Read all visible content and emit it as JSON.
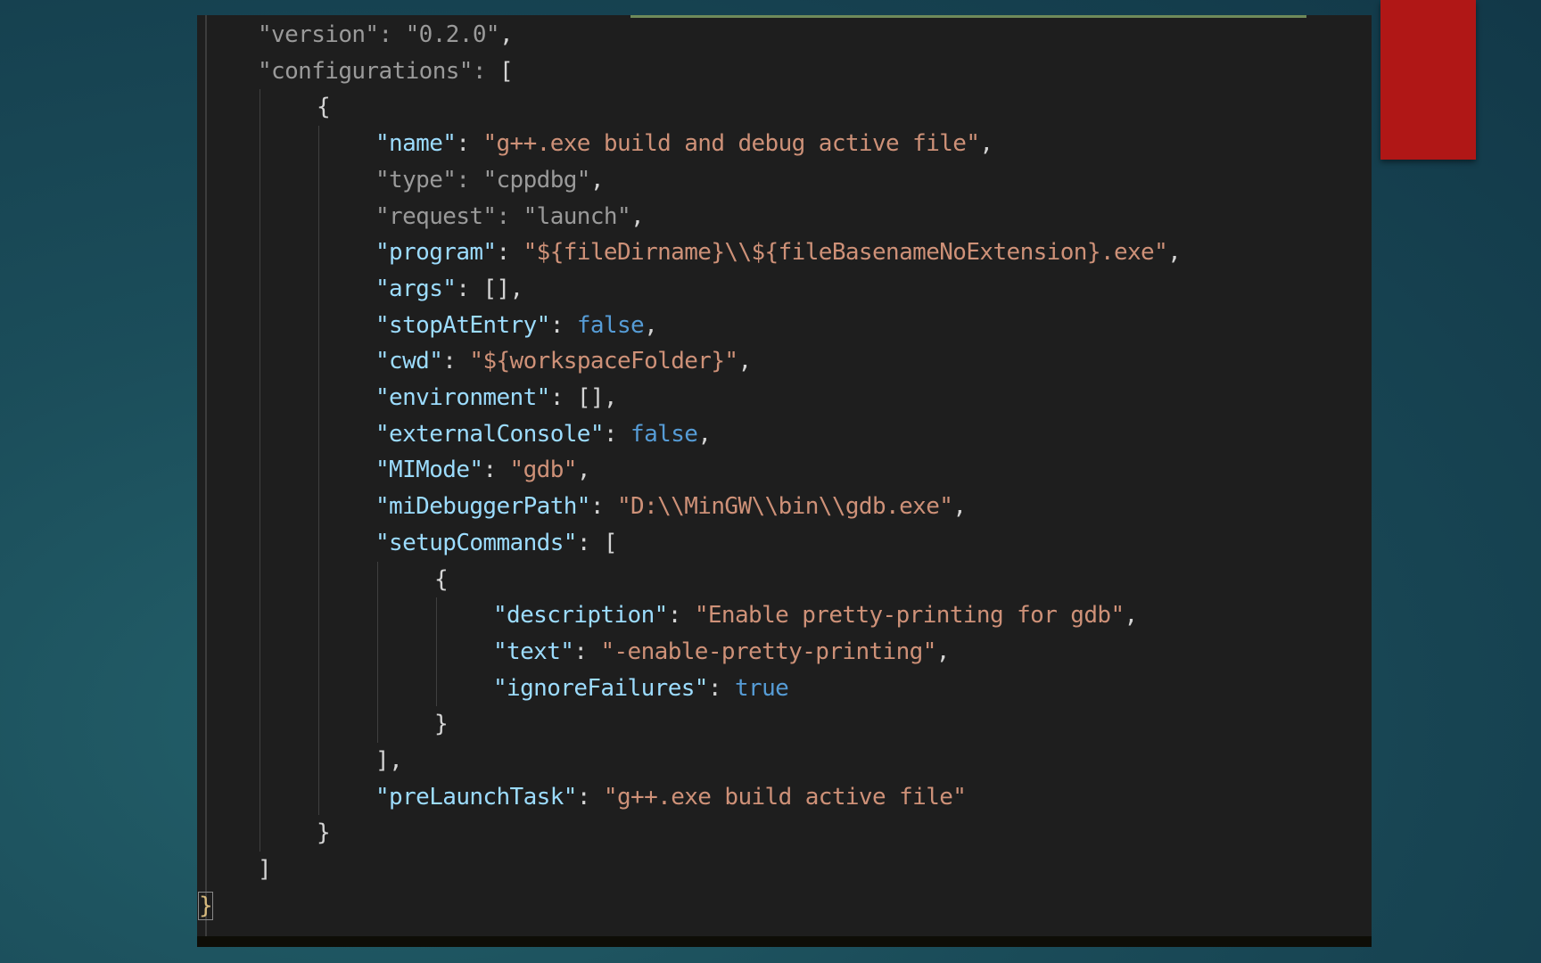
{
  "background": {
    "colors": [
      "#23606a",
      "#123848"
    ],
    "accent_color": "#b01716"
  },
  "editor": {
    "theme": {
      "background": "#1e1e1e",
      "key": "#9cdcfe",
      "string": "#ce9178",
      "boolean": "#569cd6",
      "punctuation": "#d4d4d4"
    },
    "lines": [
      {
        "indent": 1,
        "tokens": [
          [
            "dim",
            "\"version\""
          ],
          [
            "dim",
            ": "
          ],
          [
            "dim",
            "\"0.2.0\""
          ],
          [
            "p",
            ","
          ]
        ]
      },
      {
        "indent": 1,
        "tokens": [
          [
            "dim",
            "\"configurations\""
          ],
          [
            "dim",
            ": "
          ],
          [
            "p",
            "["
          ]
        ]
      },
      {
        "indent": 2,
        "tokens": [
          [
            "p",
            "{"
          ]
        ]
      },
      {
        "indent": 3,
        "tokens": [
          [
            "k",
            "\"name\""
          ],
          [
            "p",
            ": "
          ],
          [
            "s",
            "\"g++.exe build and debug active file\""
          ],
          [
            "p",
            ","
          ]
        ]
      },
      {
        "indent": 3,
        "tokens": [
          [
            "dim",
            "\"type\""
          ],
          [
            "dim",
            ": "
          ],
          [
            "dim",
            "\"cppdbg\""
          ],
          [
            "p",
            ","
          ]
        ]
      },
      {
        "indent": 3,
        "tokens": [
          [
            "dim",
            "\"request\""
          ],
          [
            "dim",
            ": "
          ],
          [
            "dim",
            "\"launch\""
          ],
          [
            "p",
            ","
          ]
        ]
      },
      {
        "indent": 3,
        "tokens": [
          [
            "k",
            "\"program\""
          ],
          [
            "p",
            ": "
          ],
          [
            "s",
            "\"${fileDirname}\\\\${fileBasenameNoExtension}.exe\""
          ],
          [
            "p",
            ","
          ]
        ]
      },
      {
        "indent": 3,
        "tokens": [
          [
            "k",
            "\"args\""
          ],
          [
            "p",
            ": "
          ],
          [
            "p",
            "[]"
          ],
          [
            "p",
            ","
          ]
        ]
      },
      {
        "indent": 3,
        "tokens": [
          [
            "k",
            "\"stopAtEntry\""
          ],
          [
            "p",
            ": "
          ],
          [
            "b",
            "false"
          ],
          [
            "p",
            ","
          ]
        ]
      },
      {
        "indent": 3,
        "tokens": [
          [
            "k",
            "\"cwd\""
          ],
          [
            "p",
            ": "
          ],
          [
            "s",
            "\"${workspaceFolder}\""
          ],
          [
            "p",
            ","
          ]
        ]
      },
      {
        "indent": 3,
        "tokens": [
          [
            "k",
            "\"environment\""
          ],
          [
            "p",
            ": "
          ],
          [
            "p",
            "[]"
          ],
          [
            "p",
            ","
          ]
        ]
      },
      {
        "indent": 3,
        "tokens": [
          [
            "k",
            "\"externalConsole\""
          ],
          [
            "p",
            ": "
          ],
          [
            "b",
            "false"
          ],
          [
            "p",
            ","
          ]
        ]
      },
      {
        "indent": 3,
        "tokens": [
          [
            "k",
            "\"MIMode\""
          ],
          [
            "p",
            ": "
          ],
          [
            "s",
            "\"gdb\""
          ],
          [
            "p",
            ","
          ]
        ]
      },
      {
        "indent": 3,
        "tokens": [
          [
            "k",
            "\"miDebuggerPath\""
          ],
          [
            "p",
            ": "
          ],
          [
            "s",
            "\"D:\\\\MinGW\\\\bin\\\\gdb.exe\""
          ],
          [
            "p",
            ","
          ]
        ]
      },
      {
        "indent": 3,
        "tokens": [
          [
            "k",
            "\"setupCommands\""
          ],
          [
            "p",
            ": "
          ],
          [
            "p",
            "["
          ]
        ]
      },
      {
        "indent": 4,
        "tokens": [
          [
            "p",
            "{"
          ]
        ]
      },
      {
        "indent": 5,
        "tokens": [
          [
            "k",
            "\"description\""
          ],
          [
            "p",
            ": "
          ],
          [
            "s",
            "\"Enable pretty-printing for gdb\""
          ],
          [
            "p",
            ","
          ]
        ]
      },
      {
        "indent": 5,
        "tokens": [
          [
            "k",
            "\"text\""
          ],
          [
            "p",
            ": "
          ],
          [
            "s",
            "\"-enable-pretty-printing\""
          ],
          [
            "p",
            ","
          ]
        ]
      },
      {
        "indent": 5,
        "tokens": [
          [
            "k",
            "\"ignoreFailures\""
          ],
          [
            "p",
            ": "
          ],
          [
            "b",
            "true"
          ]
        ]
      },
      {
        "indent": 4,
        "tokens": [
          [
            "p",
            "}"
          ]
        ]
      },
      {
        "indent": 3,
        "tokens": [
          [
            "p",
            "]"
          ],
          [
            "p",
            ","
          ]
        ]
      },
      {
        "indent": 3,
        "tokens": [
          [
            "k",
            "\"preLaunchTask\""
          ],
          [
            "p",
            ": "
          ],
          [
            "s",
            "\"g++.exe build active file\""
          ]
        ]
      },
      {
        "indent": 2,
        "tokens": [
          [
            "p",
            "}"
          ]
        ]
      },
      {
        "indent": 1,
        "tokens": [
          [
            "p",
            "]"
          ]
        ]
      },
      {
        "indent": 0,
        "tokens": [
          [
            "brk",
            "}"
          ]
        ]
      }
    ]
  }
}
